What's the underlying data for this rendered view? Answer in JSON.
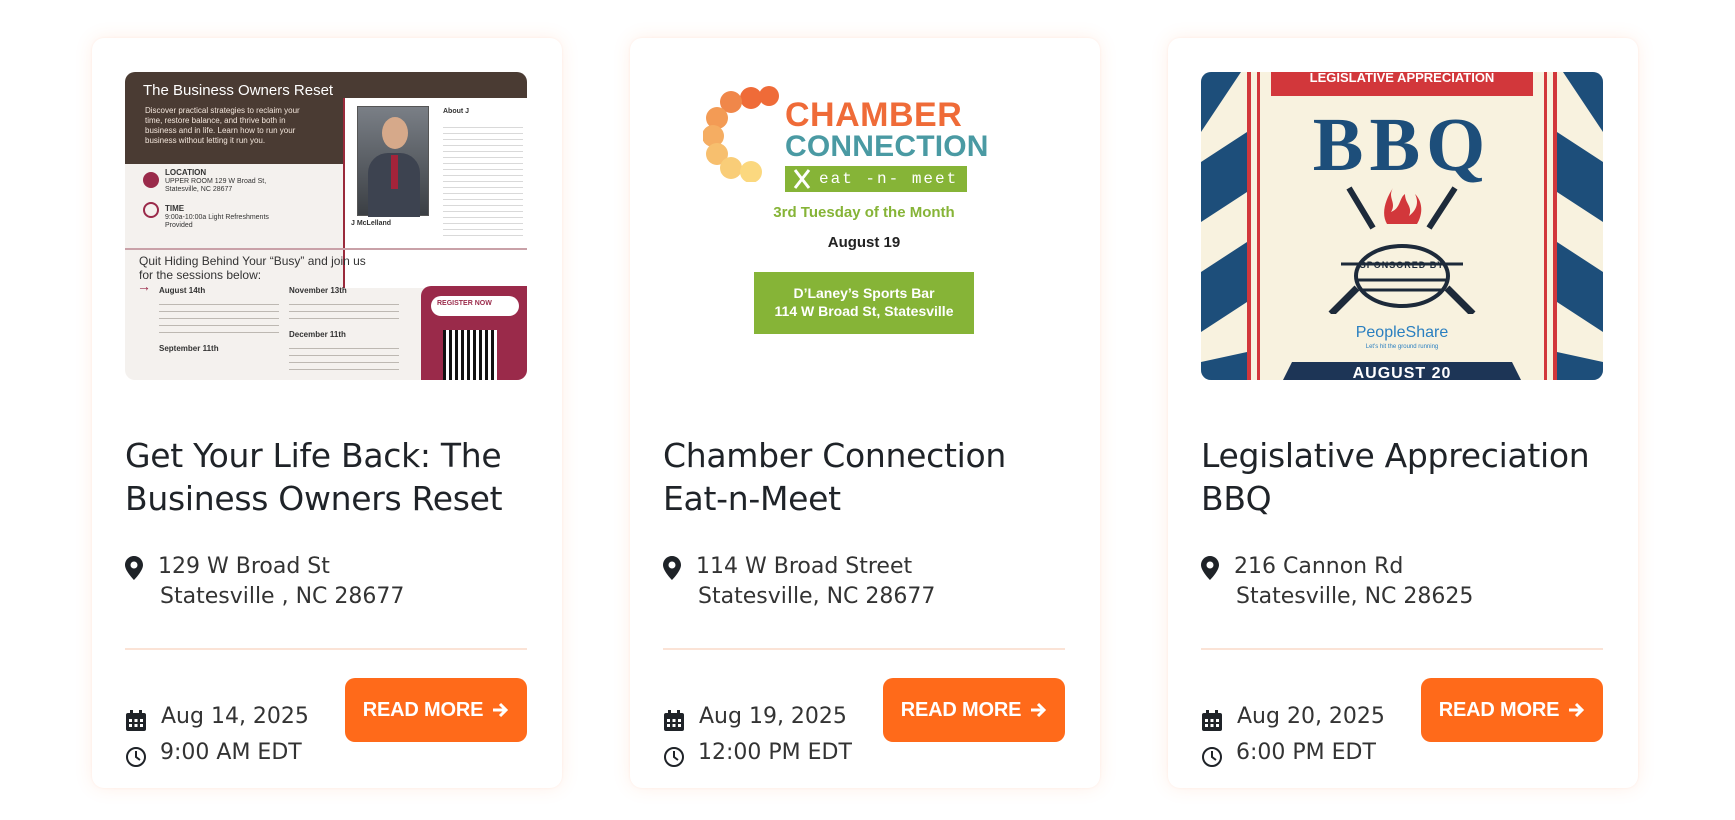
{
  "events": [
    {
      "title": "Get Your Life Back: The Business Owners Reset",
      "address_line1": "129 W Broad St",
      "address_line2": "Statesville , NC 28677",
      "date": "Aug 14, 2025",
      "time": "9:00 AM EDT",
      "button_label": "READ MORE",
      "image": {
        "heading": "The Business Owners Reset",
        "blurb": "Discover practical strategies to reclaim your time, restore balance, and thrive both in business and in life. Learn how to run your business without letting it run you.",
        "location_label": "LOCATION",
        "location_text": "UPPER ROOM 129 W Broad St, Statesville, NC 28677",
        "time_label": "TIME",
        "time_text": "9:00a-10:00a Light Refreshments Provided",
        "about_label": "About J",
        "speaker_name": "J McLelland",
        "sessions_heading": "Quit Hiding Behind Your “Busy” and join us for the sessions below:",
        "session1": "August 14th",
        "session2": "November 13th",
        "session3": "September 11th",
        "session4": "December 11th",
        "register": "REGISTER NOW"
      }
    },
    {
      "title": "Chamber Connection Eat-n-Meet",
      "address_line1": "114 W Broad Street",
      "address_line2": "Statesville, NC 28677",
      "date": "Aug 19, 2025",
      "time": "12:00 PM EDT",
      "button_label": "READ MORE",
      "image": {
        "word1": "CHAMBER",
        "word2": "CONNECTION",
        "tagline": "eat -n- meet",
        "schedule": "3rd Tuesday of the Month",
        "date": "August 19",
        "venue_line1": "D’Laney’s Sports Bar",
        "venue_line2": "114 W Broad St, Statesville"
      }
    },
    {
      "title": "Legislative Appreciation BBQ",
      "address_line1": "216 Cannon Rd",
      "address_line2": "Statesville, NC 28625",
      "date": "Aug 20, 2025",
      "time": "6:00 PM EDT",
      "button_label": "READ MORE",
      "image": {
        "banner": "LEGISLATIVE APPRECIATION",
        "big": "BBQ",
        "sponsored": "SPONSORED BY",
        "sponsor": "PeopleShare",
        "sponsor_tag": "Let's hit the ground running",
        "date": "AUGUST 20"
      }
    }
  ],
  "colors": {
    "accent": "#ff6a1a",
    "divider": "#fbe3d6"
  },
  "icons": {
    "location": "map-pin-icon",
    "date": "calendar-icon",
    "time": "clock-icon",
    "button": "arrow-right-icon"
  }
}
